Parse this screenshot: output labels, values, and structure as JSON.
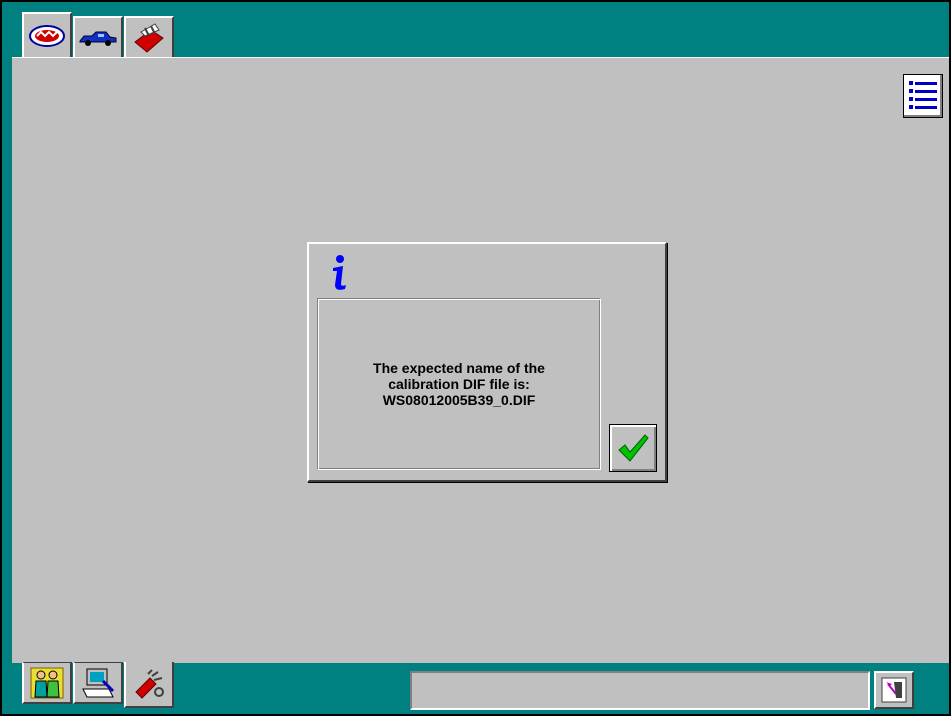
{
  "top_tabs": [
    {
      "icon": "wds-logo-icon",
      "active": true
    },
    {
      "icon": "vehicle-icon",
      "active": false
    },
    {
      "icon": "toolbox-icon",
      "active": false
    }
  ],
  "dialog": {
    "type": "info",
    "message_line1": "The expected name of the",
    "message_line2": "calibration DIF file is:",
    "message_line3": "WS08012005B39_0.DIF",
    "confirm_icon": "checkmark-icon"
  },
  "bottom_tabs": [
    {
      "icon": "people-icon",
      "active": false
    },
    {
      "icon": "computer-icon",
      "active": false
    },
    {
      "icon": "tools-icon",
      "active": true
    }
  ],
  "status": {
    "text": ""
  },
  "colors": {
    "background": "#008080",
    "panel": "#c0c0c0",
    "info_icon": "#0000ff",
    "check": "#00c000"
  }
}
